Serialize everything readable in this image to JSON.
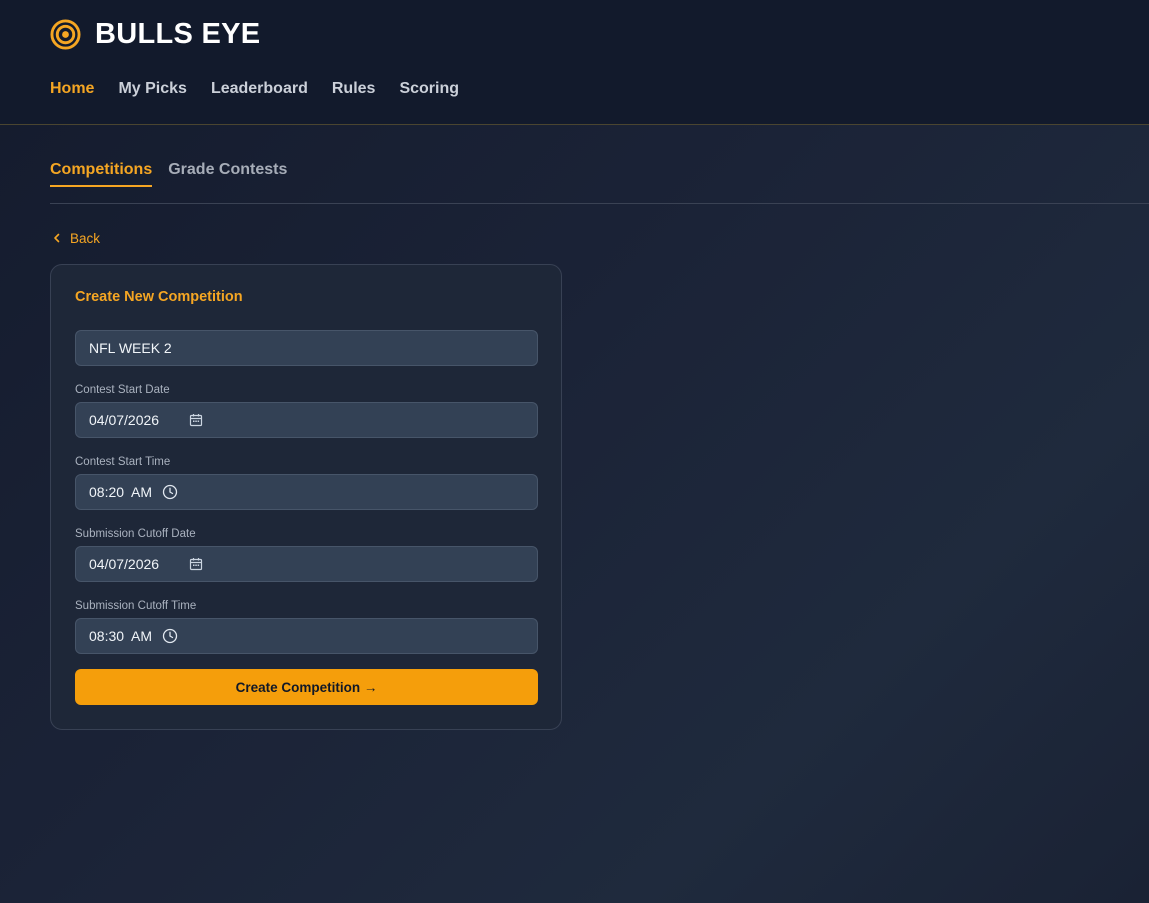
{
  "brand": {
    "title": "BULLS EYE",
    "icon": "target-icon",
    "accent_color": "#f5a623"
  },
  "nav": {
    "items": [
      {
        "label": "Home",
        "active": true
      },
      {
        "label": "My Picks",
        "active": false
      },
      {
        "label": "Leaderboard",
        "active": false
      },
      {
        "label": "Rules",
        "active": false
      },
      {
        "label": "Scoring",
        "active": false
      }
    ]
  },
  "subtabs": {
    "items": [
      {
        "label": "Competitions",
        "active": true
      },
      {
        "label": "Grade Contests",
        "active": false
      }
    ]
  },
  "back": {
    "label": "Back",
    "icon": "chevron-left-icon"
  },
  "form": {
    "title": "Create New Competition",
    "name_value": "NFL WEEK 2",
    "start_date_label": "Contest Start Date",
    "start_date_value": "04/07/2026",
    "start_time_label": "Contest Start Time",
    "start_time_value": "08:20  AM",
    "cutoff_date_label": "Submission Cutoff Date",
    "cutoff_date_value": "04/07/2026",
    "cutoff_time_label": "Submission Cutoff Time",
    "cutoff_time_value": "08:30  AM",
    "submit_label": "Create Competition →",
    "date_icon": "calendar-icon",
    "time_icon": "clock-icon",
    "button_color": "#f59e0b"
  }
}
